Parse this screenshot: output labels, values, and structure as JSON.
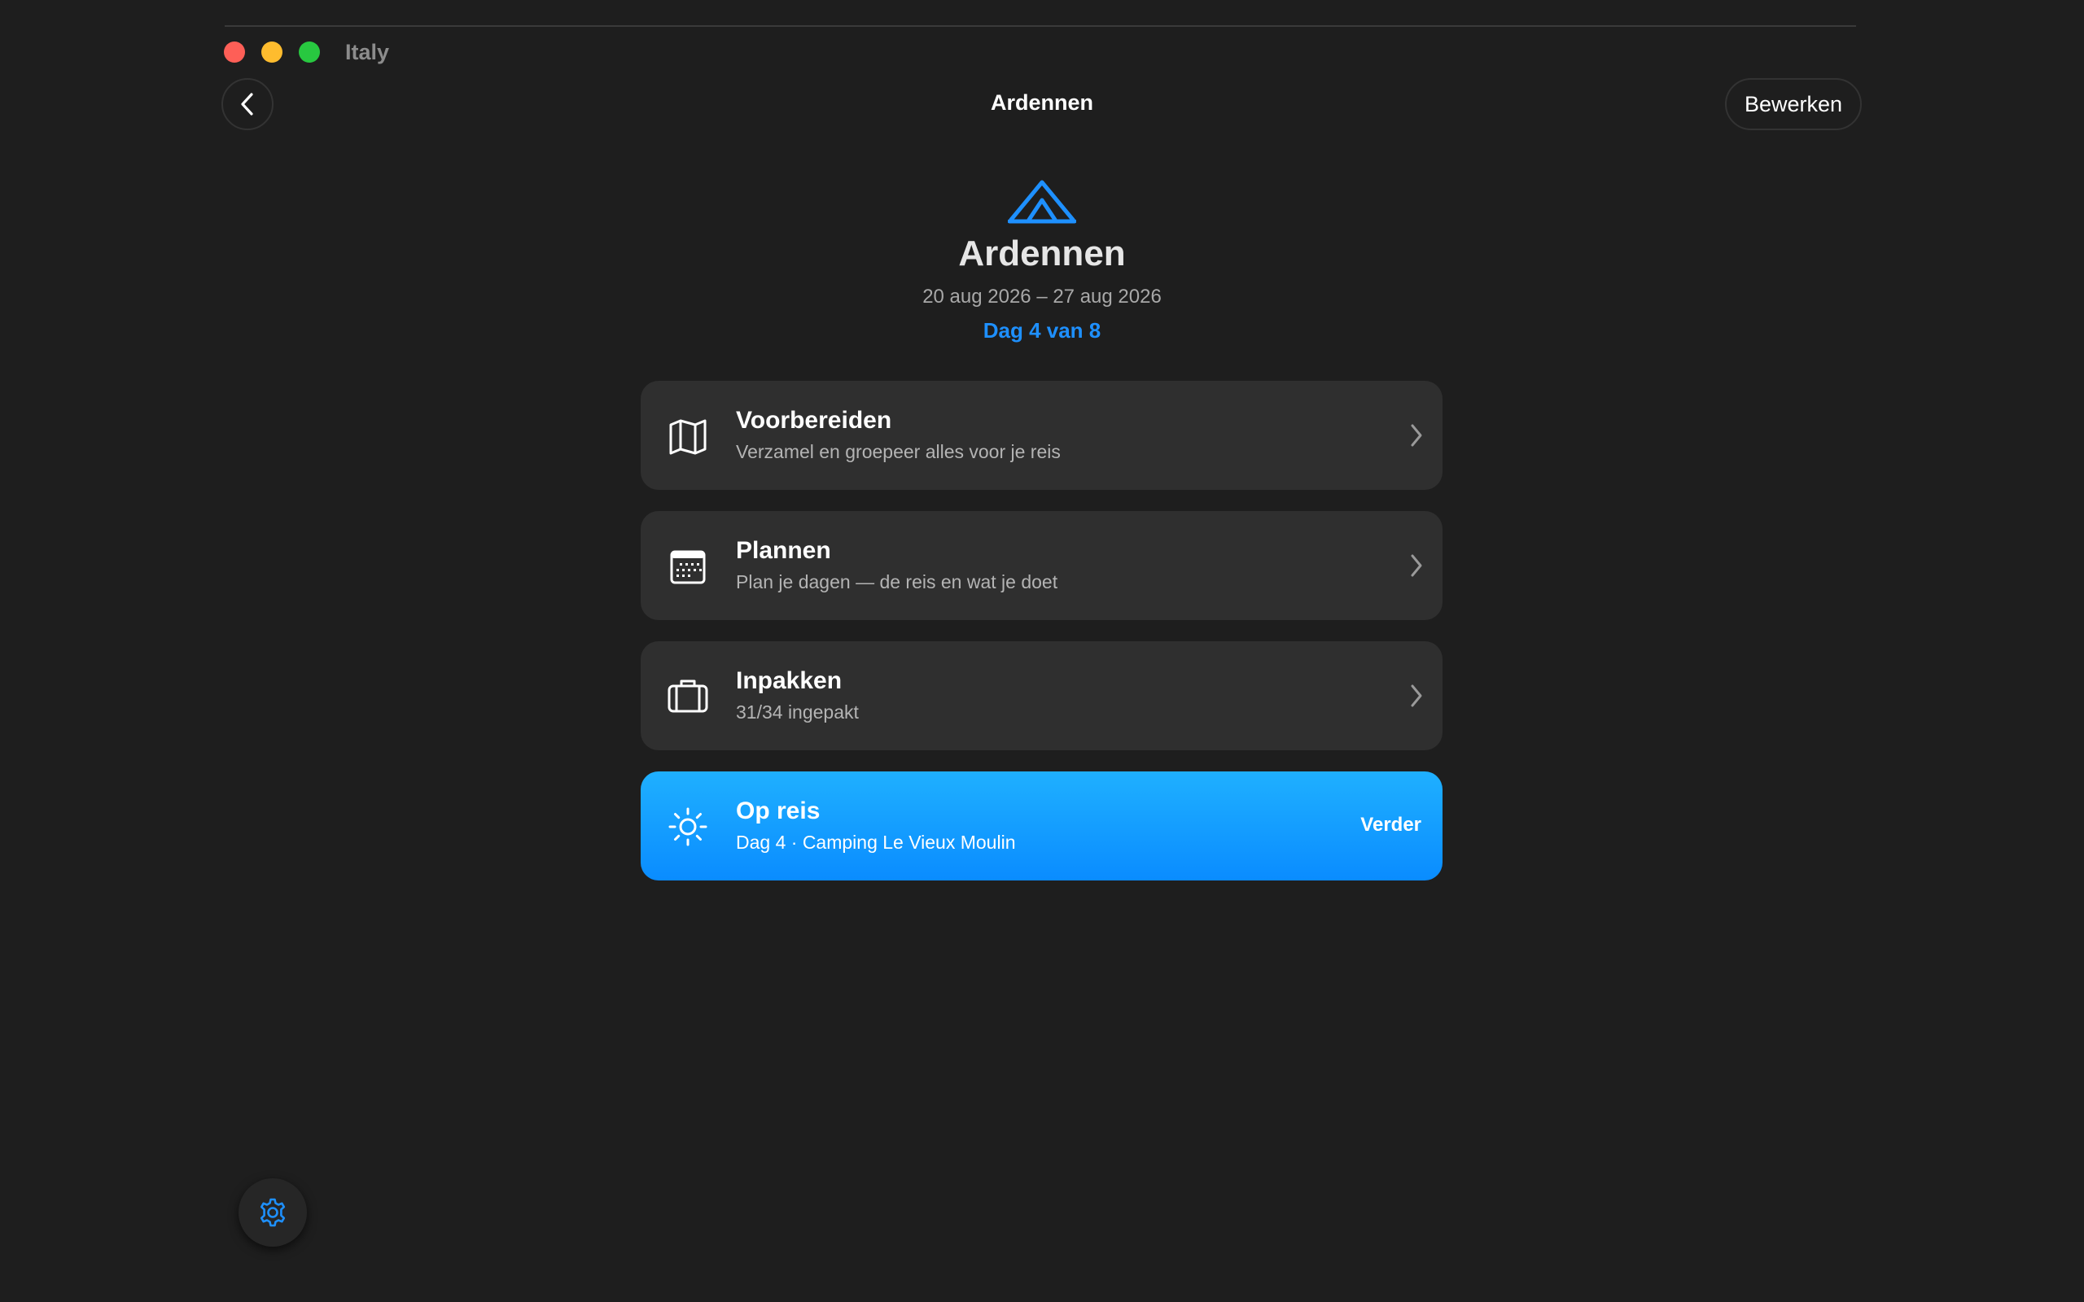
{
  "window": {
    "title": "Italy"
  },
  "nav": {
    "back_icon": "chevron-left-icon",
    "title": "Ardennen",
    "edit_label": "Bewerken"
  },
  "trip": {
    "icon": "tent-icon",
    "name": "Ardennen",
    "dates": "20 aug 2026 – 27 aug 2026",
    "day": "Dag 4 van 8"
  },
  "cards": [
    {
      "icon": "map-icon",
      "title": "Voorbereiden",
      "subtitle": "Verzamel en groepeer alles voor je reis"
    },
    {
      "icon": "calendar-icon",
      "title": "Plannen",
      "subtitle": "Plan je dagen — de reis en wat je doet"
    },
    {
      "icon": "suitcase-icon",
      "title": "Inpakken",
      "subtitle": "31/34 ingepakt"
    },
    {
      "icon": "sun-icon",
      "title": "Op reis",
      "subtitle": "Dag 4 · Camping Le Vieux Moulin",
      "action_label": "Verder"
    }
  ],
  "settings": {
    "icon": "gear-icon"
  },
  "colors": {
    "background": "#1e1e1e",
    "card": "#2f2f2f",
    "accent": "#1e90ff",
    "active_card_top": "#1fb0ff",
    "active_card_bottom": "#0a8cff",
    "traffic_close": "#fe5f57",
    "traffic_minimize": "#febc2e",
    "traffic_maximize": "#28c840"
  }
}
